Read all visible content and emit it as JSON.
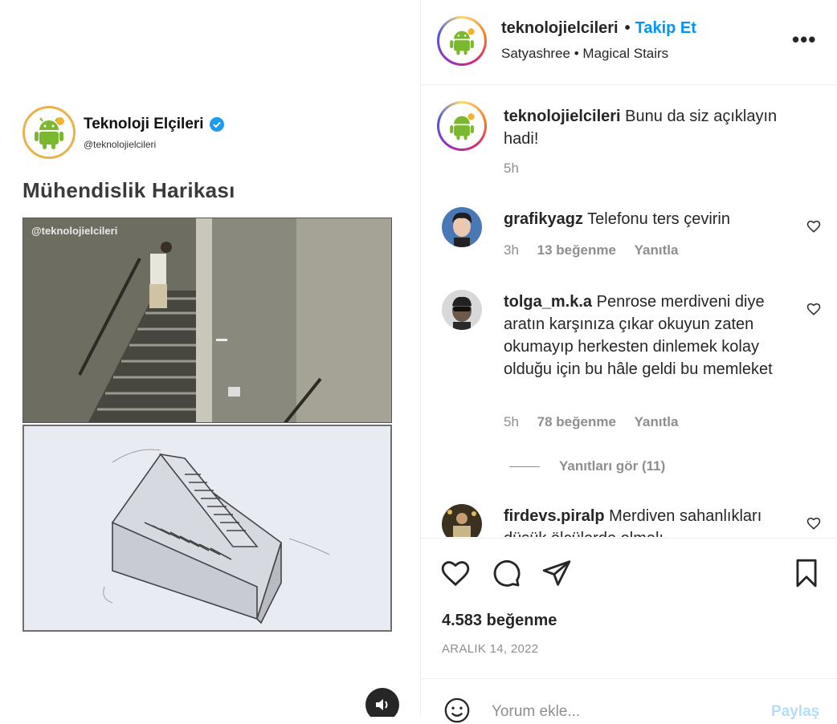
{
  "post_media": {
    "account_name": "Teknoloji Elçileri",
    "account_handle": "@teknolojielcileri",
    "headline": "Mühendislik Harikası",
    "watermark": "@teknolojielcileri"
  },
  "header": {
    "username": "teknolojielcileri",
    "separator": "•",
    "follow_label": "Takip Et",
    "audio_artist": "Satyashree",
    "audio_sep": "•",
    "audio_title": "Magical Stairs",
    "more_label": "•••"
  },
  "caption": {
    "username": "teknolojielcileri",
    "text": "Bunu da siz açıklayın hadi!",
    "time": "5h"
  },
  "comments": [
    {
      "username": "grafikyagz",
      "text": "Telefonu ters çevirin",
      "time": "3h",
      "likes": "13 beğenme",
      "reply": "Yanıtla"
    },
    {
      "username": "tolga_m.k.a",
      "text": "Penrose merdiveni diye aratın karşınıza çıkar okuyun zaten okumayıp herkesten dinlemek kolay olduğu için bu hâle geldi bu memleket",
      "time": "5h",
      "likes": "78 beğenme",
      "reply": "Yanıtla"
    },
    {
      "username": "firdevs.piralp",
      "text": "Merdiven sahanlıkları düşük ölçülerde olmalı ..."
    }
  ],
  "view_replies": "Yanıtları gör (11)",
  "actions": {
    "likes": "4.583 beğenme",
    "date": "ARALIK 14, 2022"
  },
  "add_comment": {
    "placeholder": "Yorum ekle...",
    "post_label": "Paylaş"
  },
  "colors": {
    "accent": "#0095f6",
    "muted": "#8e8e8e",
    "text": "#262626",
    "verified": "#1d9bf0"
  }
}
